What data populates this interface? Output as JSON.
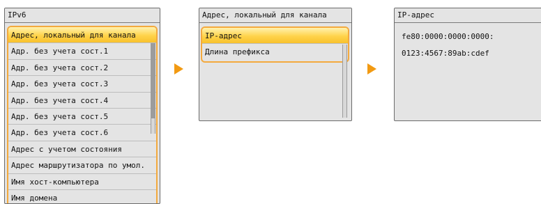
{
  "screen1": {
    "title": "IPv6",
    "items": [
      "Адрес, локальный для канала",
      "Адр. без учета сост.1",
      "Адр. без учета сост.2",
      "Адр. без учета сост.3",
      "Адр. без учета сост.4",
      "Адр. без учета сост.5",
      "Адр. без учета сост.6",
      "Адрес с учетом состояния",
      "Адрес маршрутизатора по умол.",
      "Имя хост-компьютера",
      "Имя домена"
    ],
    "selected_index": 0
  },
  "screen2": {
    "title": "Адрес, локальный для канала",
    "items": [
      "IP-адрес",
      "Длина префикса"
    ],
    "selected_index": 0
  },
  "screen3": {
    "title": "IP-адрес",
    "lines": [
      "fe80:0000:0000:0000:",
      "0123:4567:89ab:cdef"
    ]
  },
  "colors": {
    "accent_frame": "#f3a93d",
    "selection": "#ffd34a",
    "arrow": "#f29a12",
    "panel_bg": "#e4e4e4"
  },
  "icons": [
    "right-arrow-icon"
  ]
}
